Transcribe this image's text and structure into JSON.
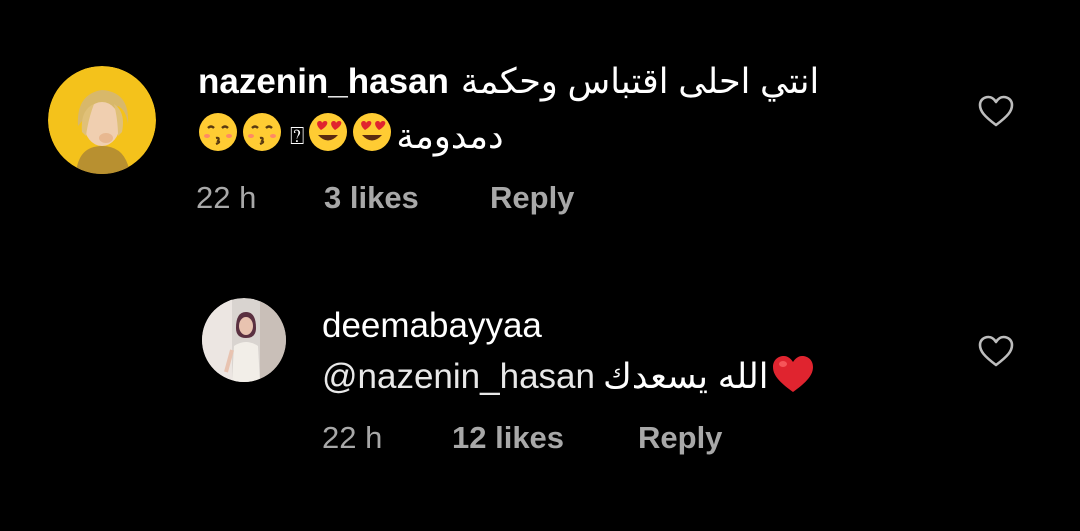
{
  "comments": [
    {
      "username": "nazenin_hasan",
      "text_line1": "انتي احلى اقتباس وحكمة",
      "text_line2": "دمدومة",
      "emojis": [
        "heart-eyes",
        "heart-eyes",
        "missing-glyph",
        "kissing-closed-eyes",
        "kissing-closed-eyes"
      ],
      "missing_glyph": "⍰",
      "time": "22 h",
      "likes": "3 likes",
      "reply": "Reply"
    },
    {
      "username": "deemabayyaa",
      "mention": "@nazenin_hasan",
      "text": "الله يسعدك",
      "emoji": "red-heart",
      "time": "22 h",
      "likes": "12 likes",
      "reply": "Reply"
    }
  ],
  "colors": {
    "background": "#000000",
    "primary_text": "#ffffff",
    "secondary_text": "#a8a8a8",
    "heart_red": "#e0242f",
    "emoji_yellow": "#ffcc33"
  }
}
